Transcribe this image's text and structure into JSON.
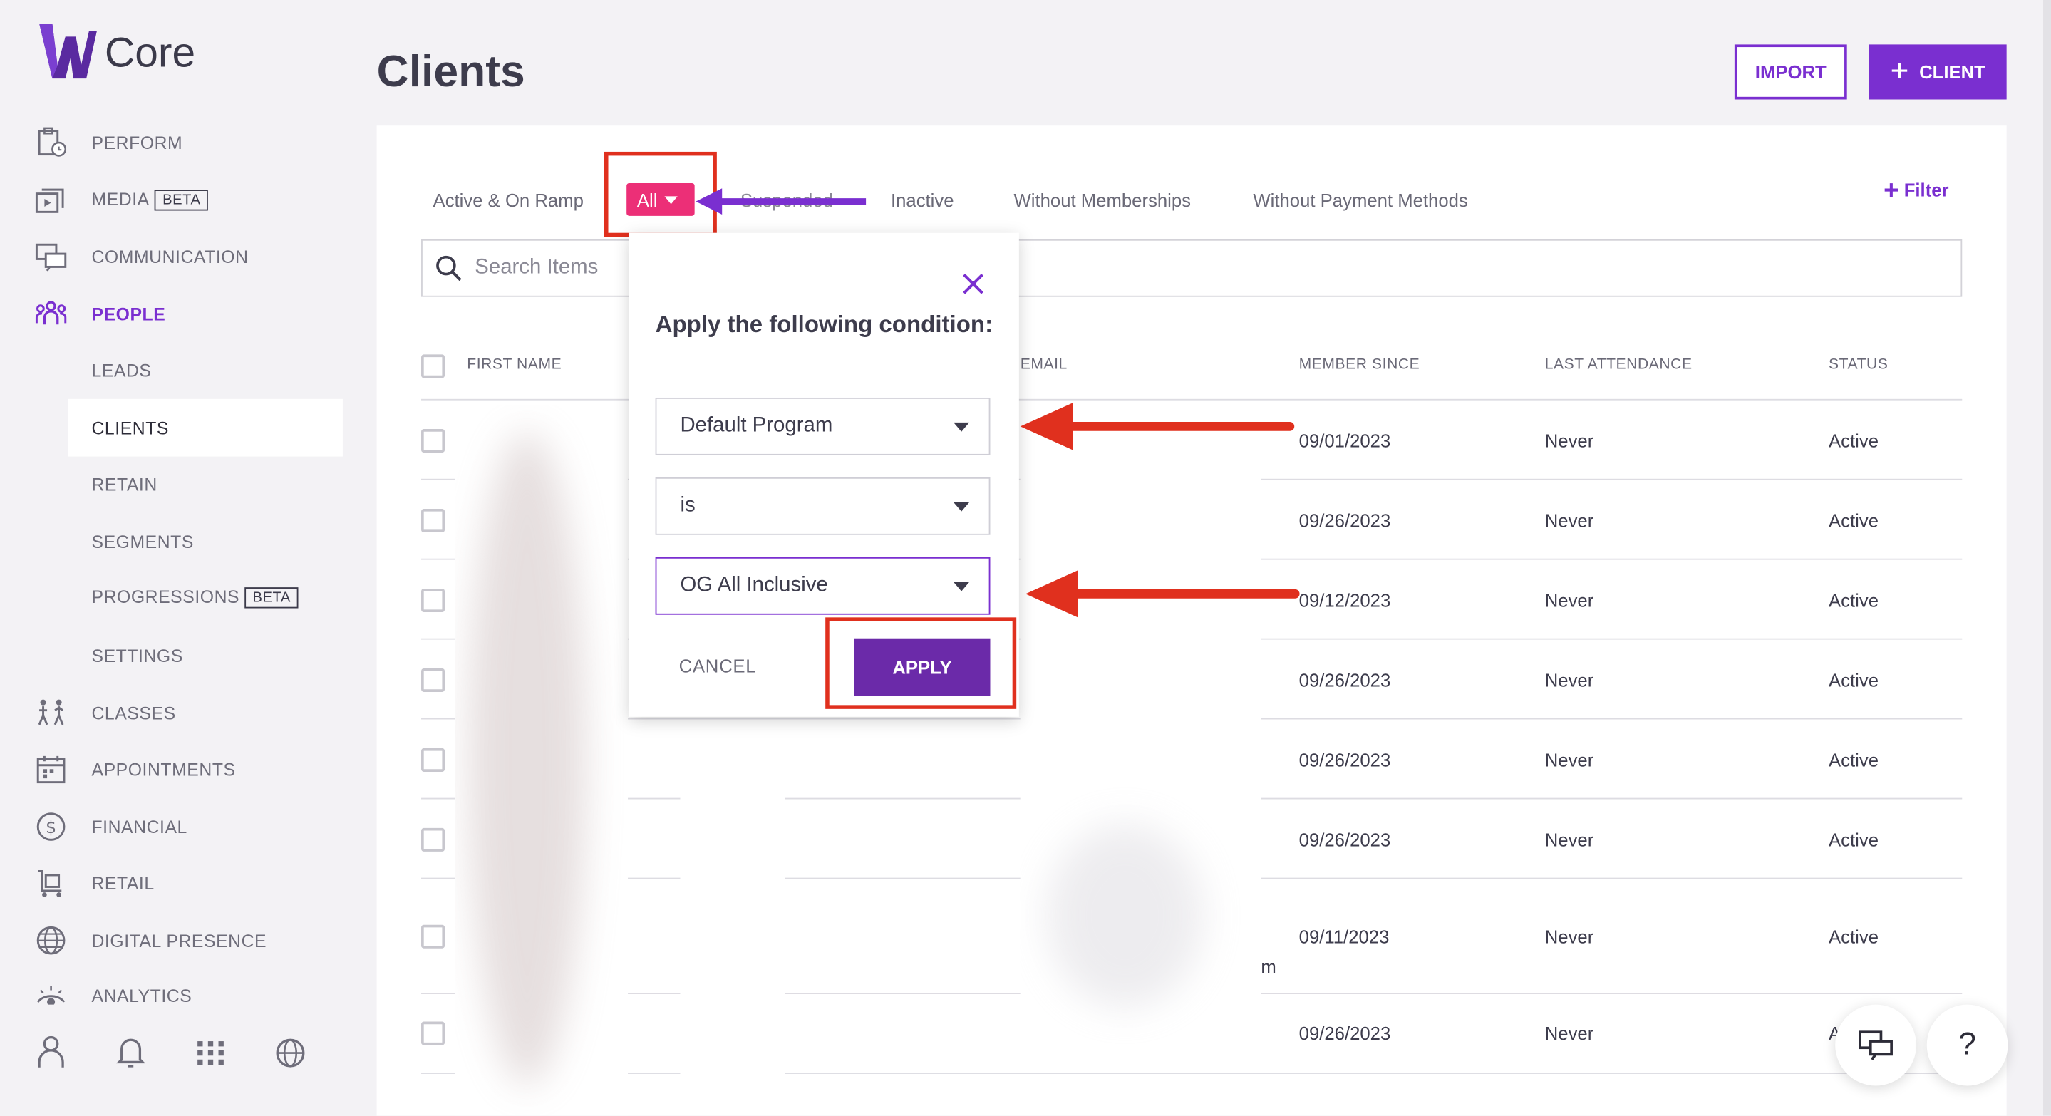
{
  "app": {
    "logo_text": "Core"
  },
  "sidebar": {
    "items": [
      {
        "label": "PERFORM",
        "icon": "clipboard-clock-icon"
      },
      {
        "label": "MEDIA",
        "badge": "BETA",
        "icon": "media-icon"
      },
      {
        "label": "COMMUNICATION",
        "icon": "chat-bubbles-icon"
      },
      {
        "label": "PEOPLE",
        "icon": "people-icon"
      },
      {
        "label": "CLASSES",
        "icon": "classes-icon"
      },
      {
        "label": "APPOINTMENTS",
        "icon": "calendar-icon"
      },
      {
        "label": "FINANCIAL",
        "icon": "dollar-circle-icon"
      },
      {
        "label": "RETAIL",
        "icon": "cart-icon"
      },
      {
        "label": "DIGITAL PRESENCE",
        "icon": "globe-icon"
      },
      {
        "label": "ANALYTICS",
        "icon": "eye-icon"
      }
    ],
    "people_sub": [
      {
        "label": "LEADS"
      },
      {
        "label": "CLIENTS"
      },
      {
        "label": "RETAIN"
      },
      {
        "label": "SEGMENTS"
      },
      {
        "label": "PROGRESSIONS",
        "badge": "BETA"
      },
      {
        "label": "SETTINGS"
      }
    ],
    "bottom_icons": [
      "user-icon",
      "bell-icon",
      "grid-icon",
      "globe-icon"
    ]
  },
  "header": {
    "title": "Clients",
    "import_label": "IMPORT",
    "client_label": "CLIENT"
  },
  "tabs": [
    "Active & On Ramp",
    "All",
    "Suspended",
    "Inactive",
    "Without Memberships",
    "Without Payment Methods"
  ],
  "filter_label": "Filter",
  "search": {
    "placeholder": "Search Items"
  },
  "table": {
    "columns": [
      "FIRST NAME",
      "EMAIL",
      "MEMBER SINCE",
      "LAST ATTENDANCE",
      "STATUS"
    ],
    "rows": [
      {
        "member_since": "09/01/2023",
        "last_attendance": "Never",
        "status": "Active"
      },
      {
        "member_since": "09/26/2023",
        "last_attendance": "Never",
        "status": "Active"
      },
      {
        "member_since": "09/12/2023",
        "last_attendance": "Never",
        "status": "Active"
      },
      {
        "member_since": "09/26/2023",
        "last_attendance": "Never",
        "status": "Active"
      },
      {
        "member_since": "09/26/2023",
        "last_attendance": "Never",
        "status": "Active"
      },
      {
        "member_since": "09/26/2023",
        "last_attendance": "Never",
        "status": "Active"
      },
      {
        "member_since": "09/11/2023",
        "last_attendance": "Never",
        "status": "Active",
        "email_fragment": "m"
      },
      {
        "member_since": "09/26/2023",
        "last_attendance": "Never",
        "status": "A"
      }
    ]
  },
  "modal": {
    "title": "Apply the following condition:",
    "field": "Default Program",
    "operator": "is",
    "value": "OG All Inclusive",
    "cancel_label": "CANCEL",
    "apply_label": "APPLY"
  },
  "fab": {
    "help_label": "?"
  },
  "colors": {
    "brand": "#7a2fd0",
    "pill": "#ec2f77",
    "annotation": "#e0301e",
    "apply": "#6b2aa9"
  }
}
